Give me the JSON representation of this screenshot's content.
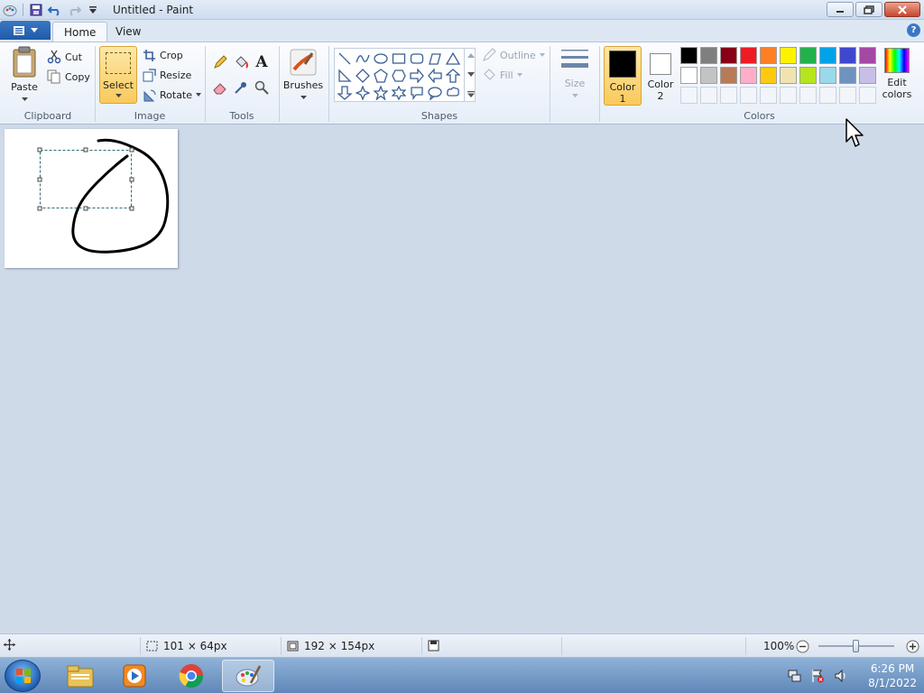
{
  "window": {
    "title": "Untitled - Paint",
    "controls": [
      "minimize",
      "restore",
      "close"
    ]
  },
  "tabs": [
    {
      "label": "Home",
      "active": true
    },
    {
      "label": "View",
      "active": false
    }
  ],
  "clipboard": {
    "paste_label": "Paste",
    "cut_label": "Cut",
    "copy_label": "Copy",
    "group_label": "Clipboard"
  },
  "image": {
    "select_label": "Select",
    "crop_label": "Crop",
    "resize_label": "Resize",
    "rotate_label": "Rotate",
    "group_label": "Image"
  },
  "tools": {
    "items": [
      "pencil-icon",
      "fill-bucket-icon",
      "text-icon",
      "eraser-icon",
      "color-picker-icon",
      "magnifier-icon"
    ],
    "text_glyph": "A",
    "group_label": "Tools"
  },
  "brushes": {
    "label": "Brushes"
  },
  "shapes": {
    "outline_label": "Outline",
    "fill_label": "Fill",
    "group_label": "Shapes"
  },
  "size": {
    "label": "Size"
  },
  "colors": {
    "color1_line1": "Color",
    "color1_line2": "1",
    "color2_line1": "Color",
    "color2_line2": "2",
    "edit_line1": "Edit",
    "edit_line2": "colors",
    "group_label": "Colors",
    "color1": "#000000",
    "color2": "#ffffff",
    "palette_row1": [
      "#000000",
      "#7f7f7f",
      "#880015",
      "#ed1c24",
      "#ff7f27",
      "#fff200",
      "#22b14c",
      "#00a2e8",
      "#3f48cc",
      "#a349a4"
    ],
    "palette_row2": [
      "#ffffff",
      "#c3c3c3",
      "#b97a57",
      "#ffaec9",
      "#ffc90e",
      "#efe4b0",
      "#b5e61d",
      "#99d9ea",
      "#7092be",
      "#c8bfe7"
    ],
    "palette_row3_count": 10
  },
  "status": {
    "selection_size": "101 × 64px",
    "image_size": "192 × 154px",
    "zoom": "100%",
    "zoom_level": 0.5
  },
  "taskbar": {
    "apps": [
      "explorer-icon",
      "media-player-icon",
      "chrome-icon",
      "paint-icon"
    ],
    "active_app": "paint-icon",
    "time": "6:26 PM",
    "date": "8/1/2022"
  }
}
